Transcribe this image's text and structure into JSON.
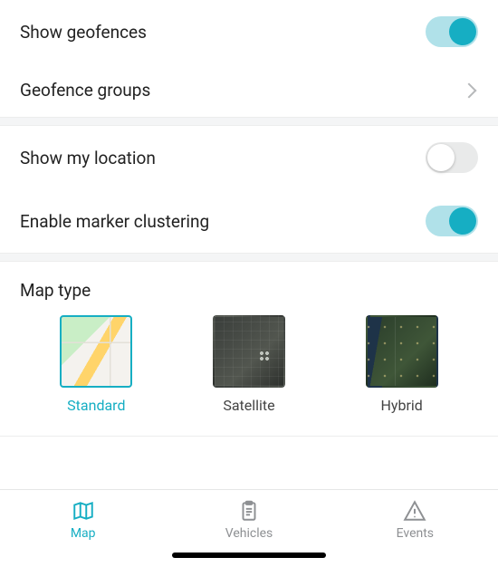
{
  "settings_group1": {
    "show_geofences": {
      "label": "Show geofences",
      "value": true
    },
    "geofence_groups": {
      "label": "Geofence groups"
    }
  },
  "settings_group2": {
    "show_my_location": {
      "label": "Show my location",
      "value": false
    },
    "enable_clustering": {
      "label": "Enable marker clustering",
      "value": true
    }
  },
  "map_type": {
    "header": "Map type",
    "selected": "standard",
    "options": [
      {
        "key": "standard",
        "label": "Standard"
      },
      {
        "key": "satellite",
        "label": "Satellite"
      },
      {
        "key": "hybrid",
        "label": "Hybrid"
      }
    ]
  },
  "tabbar": {
    "active": "map",
    "tabs": [
      {
        "key": "map",
        "label": "Map"
      },
      {
        "key": "vehicles",
        "label": "Vehicles"
      },
      {
        "key": "events",
        "label": "Events"
      }
    ]
  },
  "colors": {
    "accent": "#16aec3"
  }
}
